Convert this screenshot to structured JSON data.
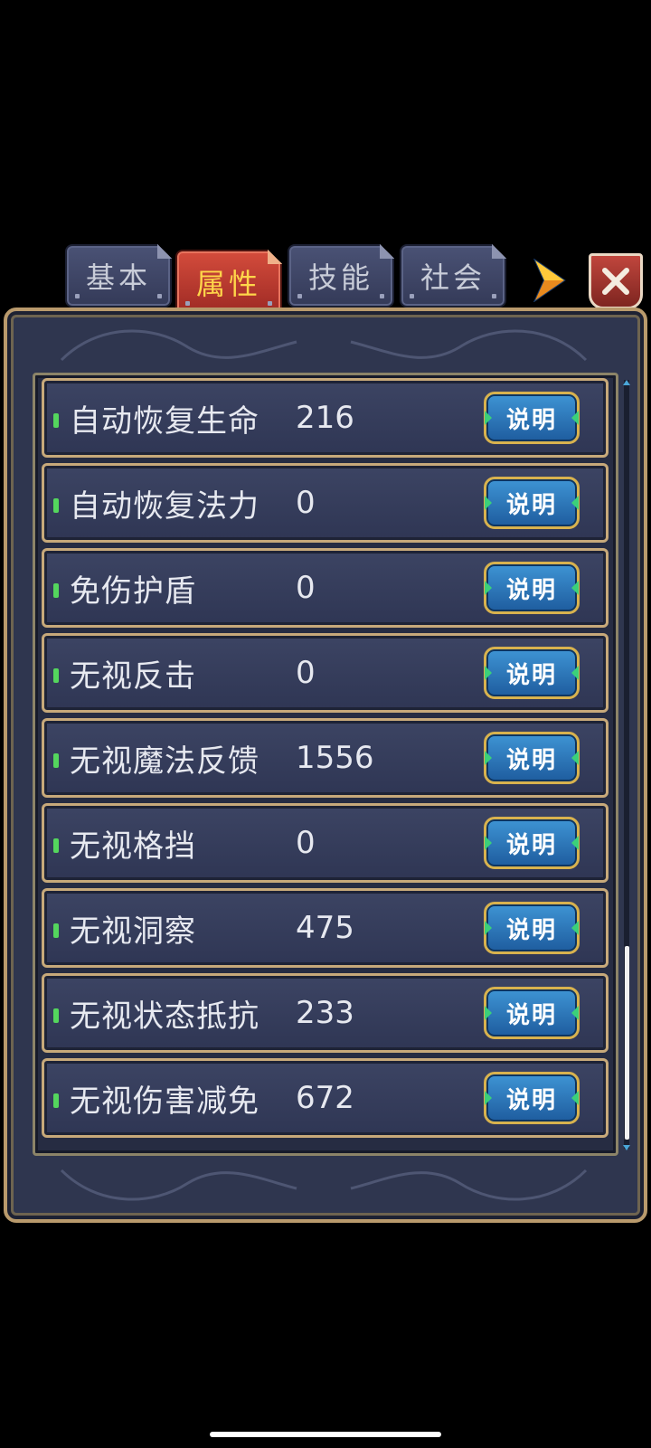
{
  "tabs": [
    {
      "label": "基本",
      "active": false
    },
    {
      "label": "属性",
      "active": true
    },
    {
      "label": "技能",
      "active": false
    },
    {
      "label": "社会",
      "active": false
    }
  ],
  "icons": {
    "next": "arrow-right-icon",
    "close": "close-icon"
  },
  "rows": [
    {
      "label": "自动恢复生命",
      "value": "216",
      "button": "说明"
    },
    {
      "label": "自动恢复法力",
      "value": "0",
      "button": "说明"
    },
    {
      "label": "免伤护盾",
      "value": "0",
      "button": "说明"
    },
    {
      "label": "无视反击",
      "value": "0",
      "button": "说明"
    },
    {
      "label": "无视魔法反馈",
      "value": "1556",
      "button": "说明"
    },
    {
      "label": "无视格挡",
      "value": "0",
      "button": "说明"
    },
    {
      "label": "无视洞察",
      "value": "475",
      "button": "说明"
    },
    {
      "label": "无视状态抵抗",
      "value": "233",
      "button": "说明"
    },
    {
      "label": "无视伤害减免",
      "value": "672",
      "button": "说明"
    }
  ],
  "colors": {
    "active_tab": "#b8382f",
    "active_tab_text": "#ffd64a",
    "row_border": "#c7a97a",
    "info_button": "#2b76ba",
    "marker": "#54d65d"
  }
}
